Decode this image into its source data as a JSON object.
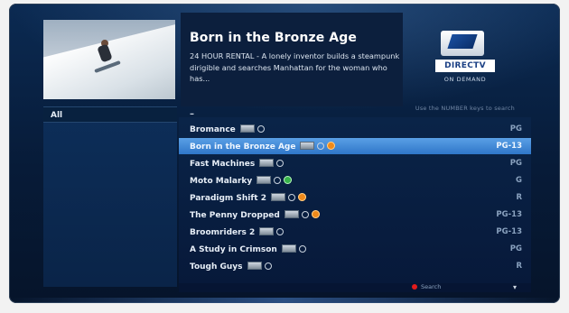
{
  "selected_item": {
    "title": "Born in the Bronze Age",
    "description": "24 HOUR RENTAL - A lonely inventor builds a steampunk dirigible and searches Manhattan for the woman who has..."
  },
  "branding": {
    "name": "DIRECTV",
    "subtitle": "ON DEMAND"
  },
  "sidebar": {
    "category": "All"
  },
  "list_header": {
    "dash": "–",
    "hint": "Use the NUMBER keys to search"
  },
  "list": {
    "items": [
      {
        "title": "Bromance",
        "rating": "PG",
        "icons": [
          "hd-icon",
          "cc-icon"
        ]
      },
      {
        "title": "Born in the Bronze Age",
        "rating": "PG-13",
        "icons": [
          "hd-icon",
          "cc-icon",
          "orange-circle-icon"
        ]
      },
      {
        "title": "Fast Machines",
        "rating": "PG",
        "icons": [
          "hd-icon",
          "cc-icon"
        ]
      },
      {
        "title": "Moto Malarky",
        "rating": "G",
        "icons": [
          "hd-icon",
          "cc-icon",
          "green-circle-icon"
        ]
      },
      {
        "title": "Paradigm Shift 2",
        "rating": "R",
        "icons": [
          "hd-icon",
          "cc-icon",
          "orange-circle-icon"
        ]
      },
      {
        "title": "The Penny Dropped",
        "rating": "PG-13",
        "icons": [
          "hd-icon",
          "cc-icon",
          "orange-circle-icon"
        ]
      },
      {
        "title": "Broomriders 2",
        "rating": "PG-13",
        "icons": [
          "hd-icon",
          "cc-icon"
        ]
      },
      {
        "title": "A Study in Crimson",
        "rating": "PG",
        "icons": [
          "hd-icon",
          "cc-icon"
        ]
      },
      {
        "title": "Tough Guys",
        "rating": "R",
        "icons": [
          "hd-icon",
          "cc-icon"
        ]
      }
    ],
    "selected_index": 1
  },
  "footer": {
    "search_label": "Search"
  },
  "colors": {
    "selection": "#3f8ad8",
    "background": "#0b2a52",
    "search_button": "#e31b1b",
    "badge_orange": "#f08a1a",
    "badge_green": "#37b24a"
  }
}
